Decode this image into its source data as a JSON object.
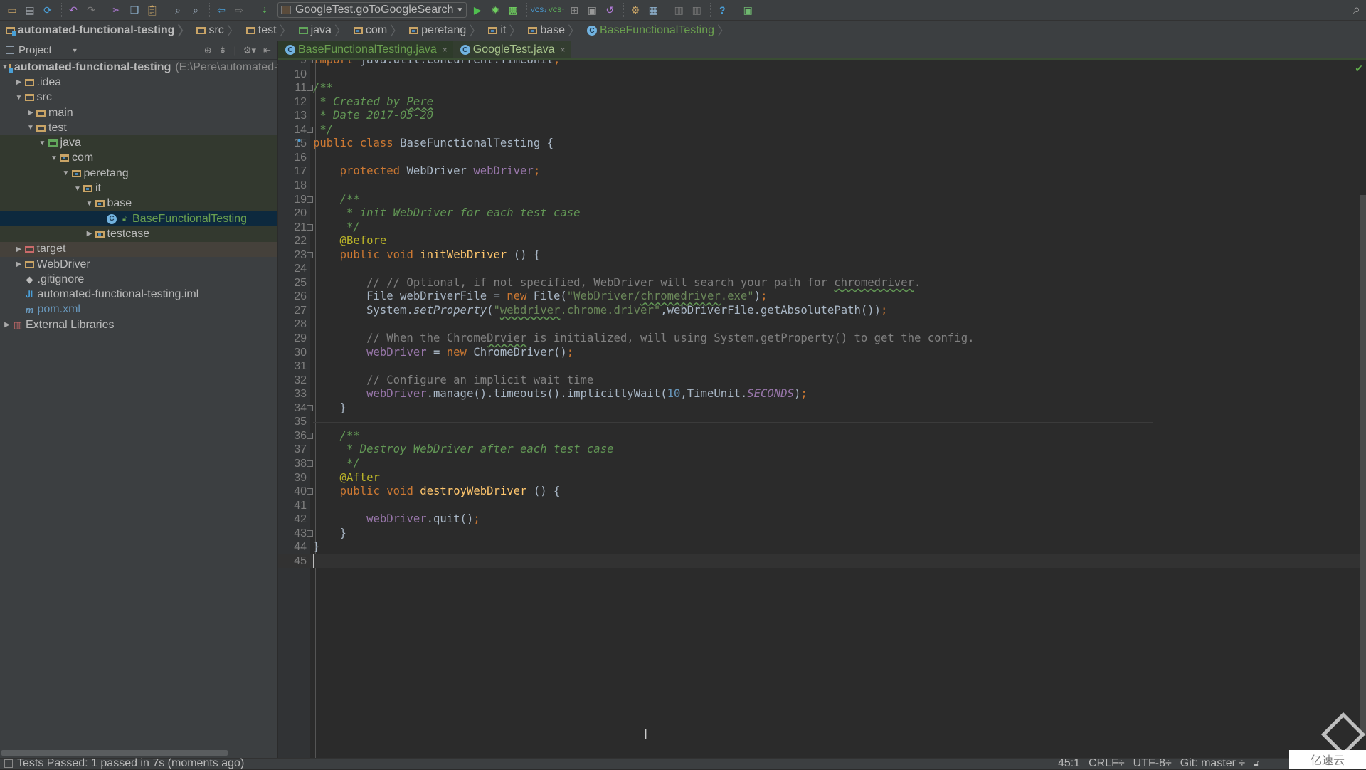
{
  "toolbar": {
    "icons": [
      "open-icon",
      "save-all-icon",
      "synchronize-icon",
      "undo-icon",
      "redo-icon",
      "cut-icon",
      "copy-icon",
      "paste-icon",
      "find-icon",
      "replace-icon",
      "back-icon",
      "forward-icon",
      "make-project-icon",
      "run-icon",
      "debug-icon",
      "coverage-icon",
      "vcs-update-icon",
      "vcs-commit-icon",
      "vcs-compare-icon",
      "vcs-history-icon",
      "vcs-revert-icon",
      "settings-icon",
      "project-structure-icon",
      "avd-manager-icon",
      "sdk-manager-icon",
      "help-icon",
      "plugin-icon"
    ],
    "run_config": "GoogleTest.goToGoogleSearch"
  },
  "breadcrumb": [
    {
      "label": "automated-functional-testing",
      "kind": "module"
    },
    {
      "label": "src",
      "kind": "folder"
    },
    {
      "label": "test",
      "kind": "folder"
    },
    {
      "label": "java",
      "kind": "test-root"
    },
    {
      "label": "com",
      "kind": "package"
    },
    {
      "label": "peretang",
      "kind": "package"
    },
    {
      "label": "it",
      "kind": "package"
    },
    {
      "label": "base",
      "kind": "package"
    },
    {
      "label": "BaseFunctionalTesting",
      "kind": "class"
    }
  ],
  "project_panel": {
    "title": "Project",
    "tree": [
      {
        "label": "automated-functional-testing",
        "extra": "(E:\\Pere\\automated-func",
        "depth": 0,
        "arrow": "down"
      },
      {
        "label": ".idea",
        "depth": 1,
        "arrow": "right"
      },
      {
        "label": "src",
        "depth": 1,
        "arrow": "down"
      },
      {
        "label": "main",
        "depth": 2,
        "arrow": "right"
      },
      {
        "label": "test",
        "depth": 2,
        "arrow": "down"
      },
      {
        "label": "java",
        "depth": 3,
        "arrow": "down"
      },
      {
        "label": "com",
        "depth": 4,
        "arrow": "down"
      },
      {
        "label": "peretang",
        "depth": 5,
        "arrow": "down"
      },
      {
        "label": "it",
        "depth": 6,
        "arrow": "down"
      },
      {
        "label": "base",
        "depth": 7,
        "arrow": "down"
      },
      {
        "label": "BaseFunctionalTesting",
        "depth": 8,
        "arrow": "none"
      },
      {
        "label": "testcase",
        "depth": 7,
        "arrow": "right"
      },
      {
        "label": "target",
        "depth": 1,
        "arrow": "right"
      },
      {
        "label": "WebDriver",
        "depth": 1,
        "arrow": "right"
      },
      {
        "label": ".gitignore",
        "depth": 1,
        "arrow": "none"
      },
      {
        "label": "automated-functional-testing.iml",
        "depth": 1,
        "arrow": "none"
      },
      {
        "label": "pom.xml",
        "depth": 1,
        "arrow": "none"
      },
      {
        "label": "External Libraries",
        "depth": 0,
        "arrow": "right"
      }
    ]
  },
  "editor": {
    "tabs": [
      {
        "label": "BaseFunctionalTesting.java",
        "active": true
      },
      {
        "label": "GoogleTest.java",
        "active": false
      }
    ],
    "lines": [
      {
        "n": "9",
        "text": "import java.util.concurrent.TimeUnit;"
      },
      {
        "n": "10",
        "text": ""
      },
      {
        "n": "11",
        "text": "/**"
      },
      {
        "n": "12",
        "text": " * Created by Pere"
      },
      {
        "n": "13",
        "text": " * Date 2017-05-20"
      },
      {
        "n": "14",
        "text": " */"
      },
      {
        "n": "15",
        "text": "public class BaseFunctionalTesting {"
      },
      {
        "n": "16",
        "text": ""
      },
      {
        "n": "17",
        "text": "    protected WebDriver webDriver;"
      },
      {
        "n": "18",
        "text": ""
      },
      {
        "n": "19",
        "text": "    /**"
      },
      {
        "n": "20",
        "text": "     * init WebDriver for each test case"
      },
      {
        "n": "21",
        "text": "     */"
      },
      {
        "n": "22",
        "text": "    @Before"
      },
      {
        "n": "23",
        "text": "    public void initWebDriver () {"
      },
      {
        "n": "24",
        "text": ""
      },
      {
        "n": "25",
        "text": "        // // Optional, if not specified, WebDriver will search your path for chromedriver."
      },
      {
        "n": "26",
        "text": "        File webDriverFile = new File(\"WebDriver/chromedriver.exe\");"
      },
      {
        "n": "27",
        "text": "        System.setProperty(\"webdriver.chrome.driver\",webDriverFile.getAbsolutePath());"
      },
      {
        "n": "28",
        "text": ""
      },
      {
        "n": "29",
        "text": "        // When the ChromeDrvier is initialized, will using System.getProperty() to get the config."
      },
      {
        "n": "30",
        "text": "        webDriver = new ChromeDriver();"
      },
      {
        "n": "31",
        "text": ""
      },
      {
        "n": "32",
        "text": "        // Configure an implicit wait time"
      },
      {
        "n": "33",
        "text": "        webDriver.manage().timeouts().implicitlyWait(10,TimeUnit.SECONDS);"
      },
      {
        "n": "34",
        "text": "    }"
      },
      {
        "n": "35",
        "text": ""
      },
      {
        "n": "36",
        "text": "    /**"
      },
      {
        "n": "37",
        "text": "     * Destroy WebDriver after each test case"
      },
      {
        "n": "38",
        "text": "     */"
      },
      {
        "n": "39",
        "text": "    @After"
      },
      {
        "n": "40",
        "text": "    public void destroyWebDriver () {"
      },
      {
        "n": "41",
        "text": ""
      },
      {
        "n": "42",
        "text": "        webDriver.quit();"
      },
      {
        "n": "43",
        "text": "    }"
      },
      {
        "n": "44",
        "text": "}"
      },
      {
        "n": "45",
        "text": ""
      }
    ]
  },
  "statusbar": {
    "message": "Tests Passed: 1 passed in 7s (moments ago)",
    "caret_position": "45:1",
    "line_separator": "CRLF",
    "encoding": "UTF-8",
    "vcs_branch": "Git: master"
  },
  "watermark": "亿速云",
  "colors": {
    "keyword": "#cc7832",
    "doc_comment": "#629755",
    "comment": "#808080",
    "annotation": "#bbb529",
    "string": "#6a8759",
    "field": "#9876aa",
    "method_decl": "#ffc66d",
    "number": "#6897bb"
  }
}
